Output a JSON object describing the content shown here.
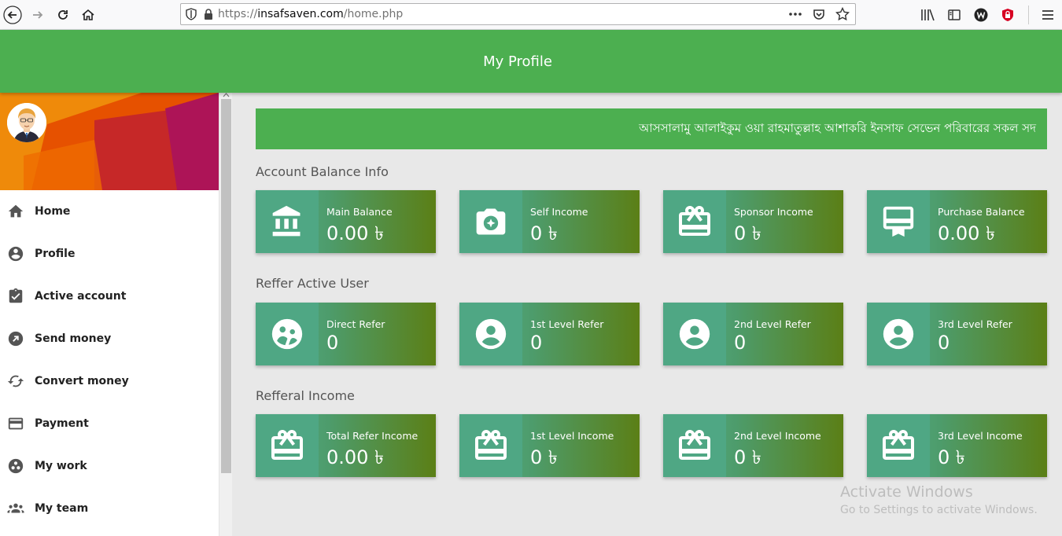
{
  "browser": {
    "url_scheme": "https://",
    "url_host": "insafsaven.com",
    "url_path": "/home.php"
  },
  "header": {
    "title": "My Profile"
  },
  "sidebar": {
    "items": [
      {
        "label": "Home",
        "icon": "home-icon"
      },
      {
        "label": "Profile",
        "icon": "account-circle-icon"
      },
      {
        "label": "Active account",
        "icon": "assignment-check-icon"
      },
      {
        "label": "Send money",
        "icon": "arrow-up-right-icon"
      },
      {
        "label": "Convert money",
        "icon": "sync-icon"
      },
      {
        "label": "Payment",
        "icon": "credit-card-icon"
      },
      {
        "label": "My work",
        "icon": "workspaces-icon"
      },
      {
        "label": "My team",
        "icon": "group-icon"
      }
    ]
  },
  "marquee": {
    "text": "আসসালামু আলাইকুম ওয়া রাহমাতুল্লাহ আশাকরি ইনসাফ সেভেন পরিবারের সকল সদ"
  },
  "sections": [
    {
      "title": "Account Balance Info",
      "cards": [
        {
          "label": "Main Balance",
          "value": "0.00 ৳",
          "icon": "bank-icon"
        },
        {
          "label": "Self Income",
          "value": "0 ৳",
          "icon": "camera-icon"
        },
        {
          "label": "Sponsor Income",
          "value": "0 ৳",
          "icon": "gift-card-icon"
        },
        {
          "label": "Purchase Balance",
          "value": "0.00 ৳",
          "icon": "card-membership-icon"
        }
      ]
    },
    {
      "title": "Reffer Active User",
      "cards": [
        {
          "label": "Direct Refer",
          "value": "0",
          "icon": "group-circle-icon"
        },
        {
          "label": "1st Level Refer",
          "value": "0",
          "icon": "account-circle-icon"
        },
        {
          "label": "2nd Level Refer",
          "value": "0",
          "icon": "account-circle-icon"
        },
        {
          "label": "3rd Level Refer",
          "value": "0",
          "icon": "account-circle-icon"
        }
      ]
    },
    {
      "title": "Refferal Income",
      "cards": [
        {
          "label": "Total Refer Income",
          "value": "0.00 ৳",
          "icon": "gift-card-icon"
        },
        {
          "label": "1st Level Income",
          "value": "0 ৳",
          "icon": "gift-card-icon"
        },
        {
          "label": "2nd Level Income",
          "value": "0 ৳",
          "icon": "gift-card-icon"
        },
        {
          "label": "3rd Level Income",
          "value": "0 ৳",
          "icon": "gift-card-icon"
        }
      ]
    }
  ],
  "watermark": {
    "line1": "Activate Windows",
    "line2": "Go to Settings to activate Windows."
  },
  "colors": {
    "header": "#4caf50",
    "card_start": "#59b28c",
    "card_end": "#5b7f16"
  }
}
